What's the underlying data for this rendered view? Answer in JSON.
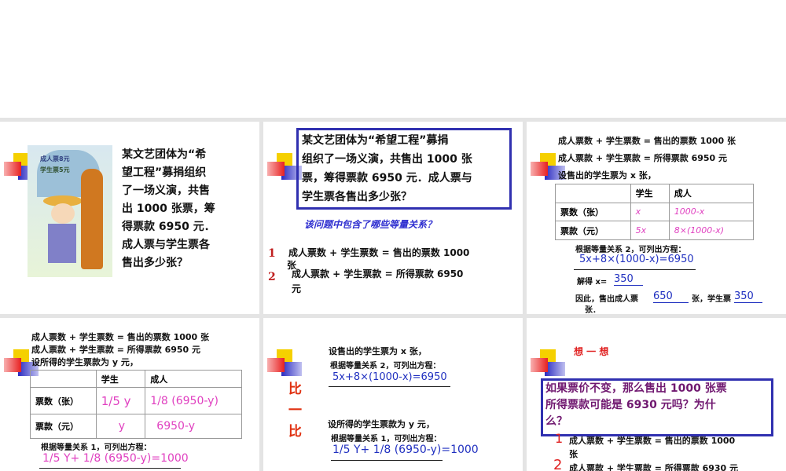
{
  "slide1": {
    "lines": [
      "某文艺团体为“希",
      "望工程”募捐组织",
      "了一场义演，共售",
      "出 1000 张票，筹",
      "得票款 6950 元．",
      "成人票与学生票各",
      "售出多少张？"
    ],
    "image_sign": [
      "成人票8元",
      "学生票5元"
    ]
  },
  "slide2": {
    "problem": [
      "某文艺团体为“希望工程”募捐",
      "组织了一场义演，共售出 1000 张",
      "票，筹得票款 6950 元．成人票与",
      "学生票各售出多少张？"
    ],
    "question": "该问题中包含了哪些等量关系？",
    "items": [
      {
        "num": "1",
        "text": "成人票数 + 学生票数 = 售出的票数 1000",
        "cont": "张"
      },
      {
        "num": "2",
        "text": "成人票款 + 学生票款 = 所得票款 6950",
        "cont": "元"
      }
    ]
  },
  "slide3": {
    "lines": [
      "成人票数 + 学生票数 = 售出的票数 1000 张",
      "成人票款 + 学生票款 = 所得票款 6950 元",
      "设售出的学生票为 x 张，"
    ],
    "table": {
      "headers": [
        "",
        "学生",
        "成人"
      ],
      "rows": [
        [
          "票数（张）",
          "x",
          "1000-x"
        ],
        [
          "票款（元）",
          "5x",
          "8×(1000-x)"
        ]
      ]
    },
    "eq_label": "根据等量关系 2，可列出方程：",
    "equation": "5x+8×(1000-x)=6950",
    "solve_label": "解得 x=",
    "solve_value": "350",
    "conclusion_a": "因此，售出成人票",
    "adult": "650",
    "conclusion_b": "张，学生票",
    "student": "350",
    "conclusion_c": "张．"
  },
  "slide4": {
    "lines": [
      "成人票数 + 学生票数 = 售出的票数 1000 张",
      "成人票款 + 学生票款 = 所得票款 6950 元",
      "设所得的学生票款为 y 元，"
    ],
    "table": {
      "headers": [
        "",
        "学生",
        "成人"
      ],
      "rows": [
        [
          "票数（张）",
          "1/5 y",
          "1/8 (6950-y)"
        ],
        [
          "票款（元）",
          "y",
          "6950-y"
        ]
      ]
    },
    "eq_label": "根据等量关系 1，可列出方程：",
    "equation": "1/5 Y+ 1/8 (6950-y)=1000"
  },
  "slide5": {
    "title": [
      "比",
      "一",
      "比"
    ],
    "a_line1": "设售出的学生票为 x 张，",
    "a_line2": "根据等量关系 2，可列出方程：",
    "a_eq": "5x+8×(1000-x)=6950",
    "b_line1": "设所得的学生票款为 y 元，",
    "b_line2": "根据等量关系 1，可列出方程：",
    "b_eq": "1/5 Y+ 1/8 (6950-y)=1000"
  },
  "slide6": {
    "title": "想 一 想",
    "question": [
      "如果票价不变，那么售出 1000 张票",
      "所得票款可能是 6930 元吗？为什",
      "么？"
    ],
    "items": [
      {
        "num": "1",
        "text": "成人票数 + 学生票数 = 售出的票数 1000",
        "cont": "张"
      },
      {
        "num": "2",
        "text": "成人票款 + 学生票款 = 所得票款 6930 元"
      }
    ]
  }
}
